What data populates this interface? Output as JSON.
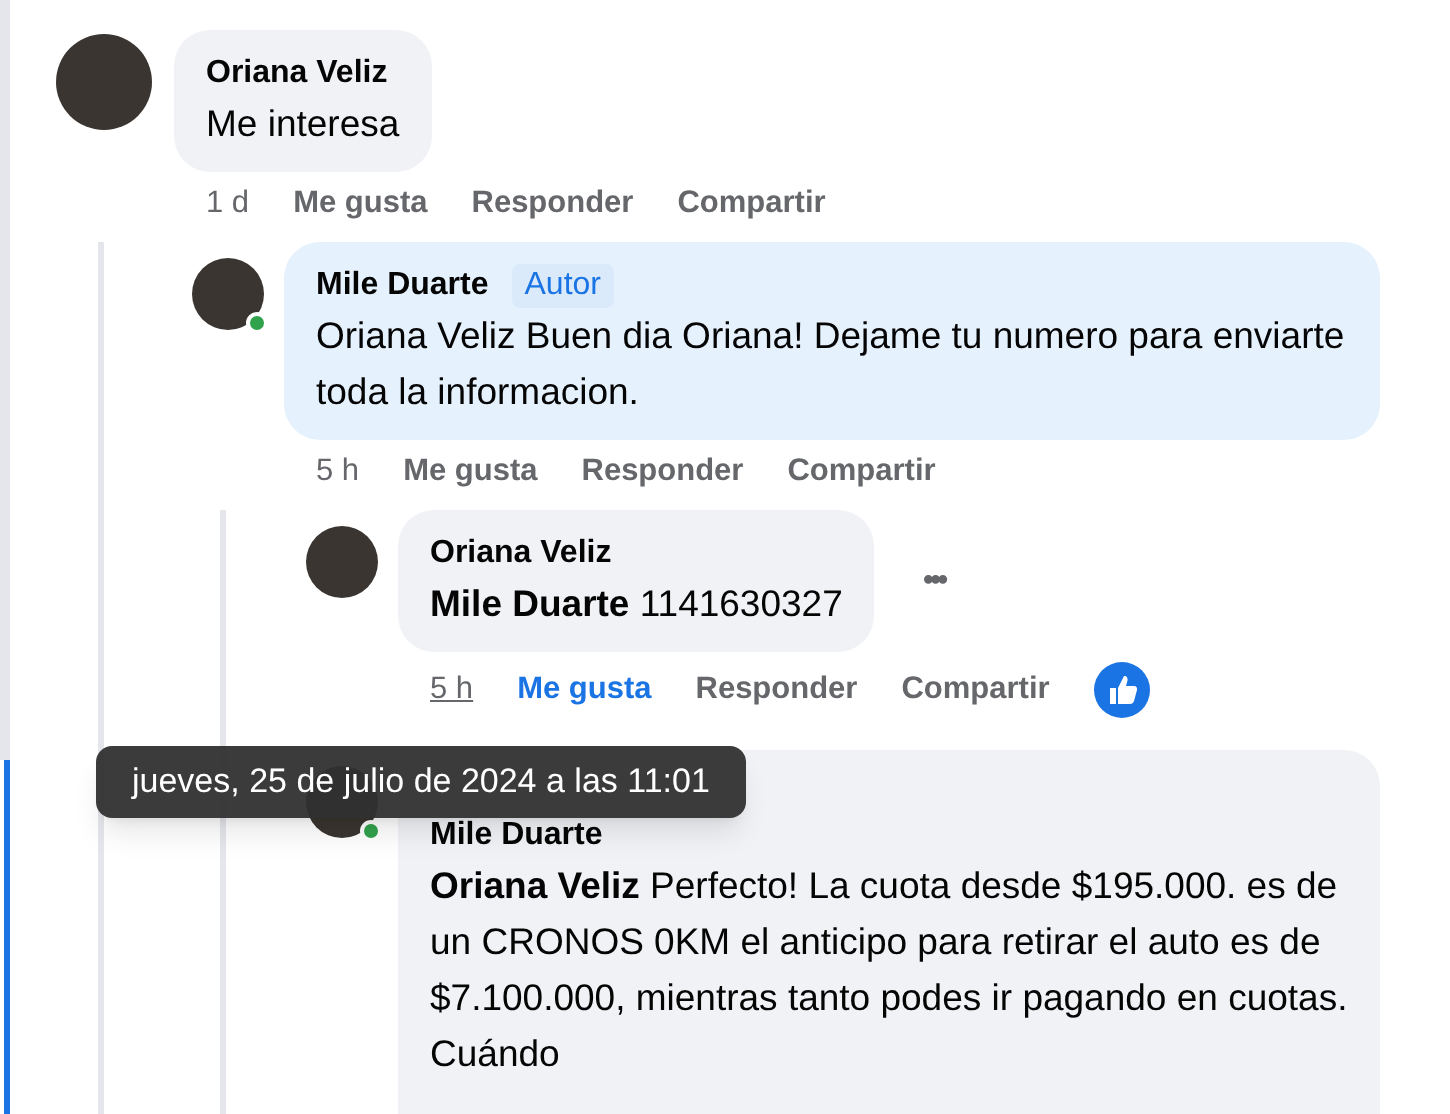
{
  "comments": [
    {
      "author": "Oriana Veliz",
      "text": "Me interesa",
      "time": "1 d",
      "time_hovered": false,
      "like_label": "Me gusta",
      "liked": false,
      "reply_label": "Responder",
      "share_label": "Compartir",
      "kind": "plain",
      "replies": [
        {
          "author": "Mile Duarte",
          "author_badge": "Autor",
          "text": "Oriana Veliz Buen dia Oriana! Dejame tu numero para enviarte toda la informacion.",
          "time": "5 h",
          "time_hovered": false,
          "like_label": "Me gusta",
          "liked": false,
          "reply_label": "Responder",
          "share_label": "Compartir",
          "kind": "author",
          "online": true,
          "replies": [
            {
              "author": "Oriana Veliz",
              "text": "**Mile Duarte** 1141630327",
              "time": "5 h",
              "time_hovered": true,
              "like_label": "Me gusta",
              "liked": true,
              "reply_label": "Responder",
              "share_label": "Compartir",
              "kind": "plain",
              "more_menu": "•••"
            },
            {
              "author": "Mile Duarte",
              "text": "**Oriana Veliz** Perfecto! La cuota desde $195.000. es de un CRONOS 0KM el anticipo para retirar el auto es de $7.100.000, mientras tanto podes ir pagando en cuotas. Cuándo",
              "kind": "plain",
              "online": true
            }
          ]
        }
      ]
    }
  ],
  "tooltip": "jueves, 25 de julio de 2024 a las 11:01"
}
